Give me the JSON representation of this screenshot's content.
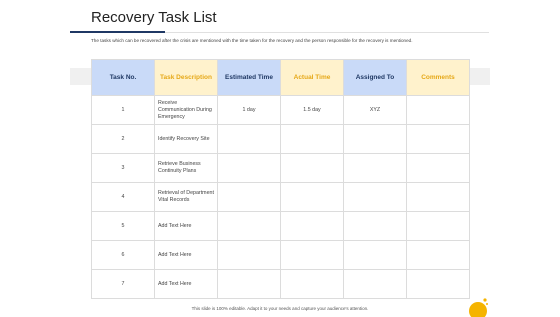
{
  "page": {
    "title": "Recovery Task List",
    "description": "The tasks which can be recovered after the crisis are mentioned with the time taken for the recovery and the person responsible for the recovery is mentioned.",
    "footer": "This slide is 100% editable. Adapt it to your needs and capture your audience's attention."
  },
  "table": {
    "headers": [
      "Task No.",
      "Task Description",
      "Estimated Time",
      "Actual Time",
      "Assigned To",
      "Comments"
    ],
    "rows": [
      [
        "1",
        "Receive Communication During Emergency",
        "1 day",
        "1.5 day",
        "XYZ",
        ""
      ],
      [
        "2",
        "Identify Recovery Site",
        "",
        "",
        "",
        ""
      ],
      [
        "3",
        "Retrieve Business Continuity Plans",
        "",
        "",
        "",
        ""
      ],
      [
        "4",
        "Retrieval of Department Vital Records",
        "",
        "",
        "",
        ""
      ],
      [
        "5",
        "Add Text Here",
        "",
        "",
        "",
        ""
      ],
      [
        "6",
        "Add Text Here",
        "",
        "",
        "",
        ""
      ],
      [
        "7",
        "Add Text Here",
        "",
        "",
        "",
        ""
      ]
    ]
  },
  "colors": {
    "header_blue": "#c9daf8",
    "header_yellow": "#fff2cc",
    "title_accent": "#1f3864",
    "sun": "#f5b400"
  },
  "icons": [
    "sun-icon"
  ]
}
